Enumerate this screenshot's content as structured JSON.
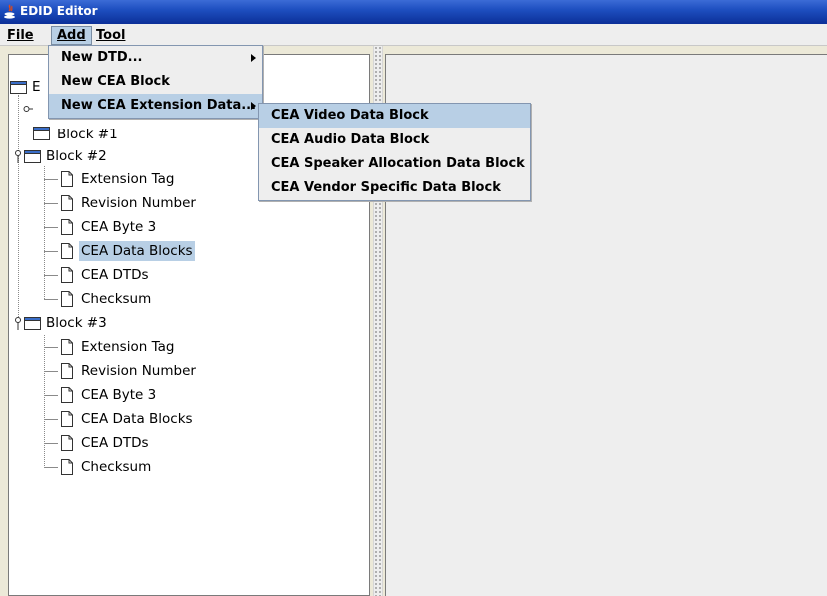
{
  "window": {
    "title": "EDID Editor"
  },
  "menubar": {
    "items": [
      "File",
      "Add",
      "Tool"
    ]
  },
  "add_menu": {
    "items": [
      {
        "label": "New DTD...",
        "submenu": true
      },
      {
        "label": "New CEA Block",
        "submenu": false
      },
      {
        "label": "New CEA Extension Data...",
        "submenu": true
      }
    ]
  },
  "cea_submenu": {
    "items": [
      "CEA Video Data Block",
      "CEA Audio Data Block",
      "CEA Speaker Allocation Data Block",
      "CEA Vendor Specific Data Block"
    ]
  },
  "tree": {
    "root_label_fragment": "E",
    "block1_label": "Block #1",
    "block2": {
      "label": "Block #2",
      "children": [
        "Extension Tag",
        "Revision Number",
        "CEA Byte 3",
        "CEA Data Blocks",
        "CEA DTDs",
        "Checksum"
      ],
      "selected": "CEA Data Blocks"
    },
    "block3": {
      "label": "Block #3",
      "children": [
        "Extension Tag",
        "Revision Number",
        "CEA Byte 3",
        "CEA Data Blocks",
        "CEA DTDs",
        "Checksum"
      ]
    }
  },
  "colors": {
    "title_bar": "#0b2f98",
    "selection": "#b8cfe5",
    "menu_bg": "#eeeeee"
  }
}
